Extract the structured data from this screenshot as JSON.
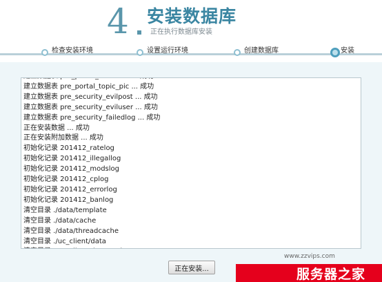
{
  "header": {
    "step_number": "4",
    "title": "安装数据库",
    "subtitle": "正在执行数据库安装"
  },
  "steps": [
    {
      "label": "检查安装环境",
      "active": false
    },
    {
      "label": "设置运行环境",
      "active": false
    },
    {
      "label": "创建数据库",
      "active": false
    },
    {
      "label": "安装",
      "active": true
    }
  ],
  "log_lines": [
    "建立数据表 pre_portal_rsscache ... 成功",
    "建立数据表 pre_portal_topic_pic ... 成功",
    "建立数据表 pre_security_evilpost ... 成功",
    "建立数据表 pre_security_eviluser ... 成功",
    "建立数据表 pre_security_failedlog ... 成功",
    "正在安装数据 ... 成功",
    "正在安装附加数据 ... 成功",
    "初始化记录 201412_ratelog",
    "初始化记录 201412_illegallog",
    "初始化记录 201412_modslog",
    "初始化记录 201412_cplog",
    "初始化记录 201412_errorlog",
    "初始化记录 201412_banlog",
    "清空目录 ./data/template",
    "清空目录 ./data/cache",
    "清空目录 ./data/threadcache",
    "清空目录 ./uc_client/data",
    "清空目录 ./uc_client/data/cache"
  ],
  "install_button": "正在安装...",
  "watermark": {
    "url": "www.zzvips.com",
    "text": "服务器之家"
  },
  "colors": {
    "accent": "#3b86a2",
    "content_bg": "#eef6f9",
    "watermark_red": "#e5001c"
  }
}
